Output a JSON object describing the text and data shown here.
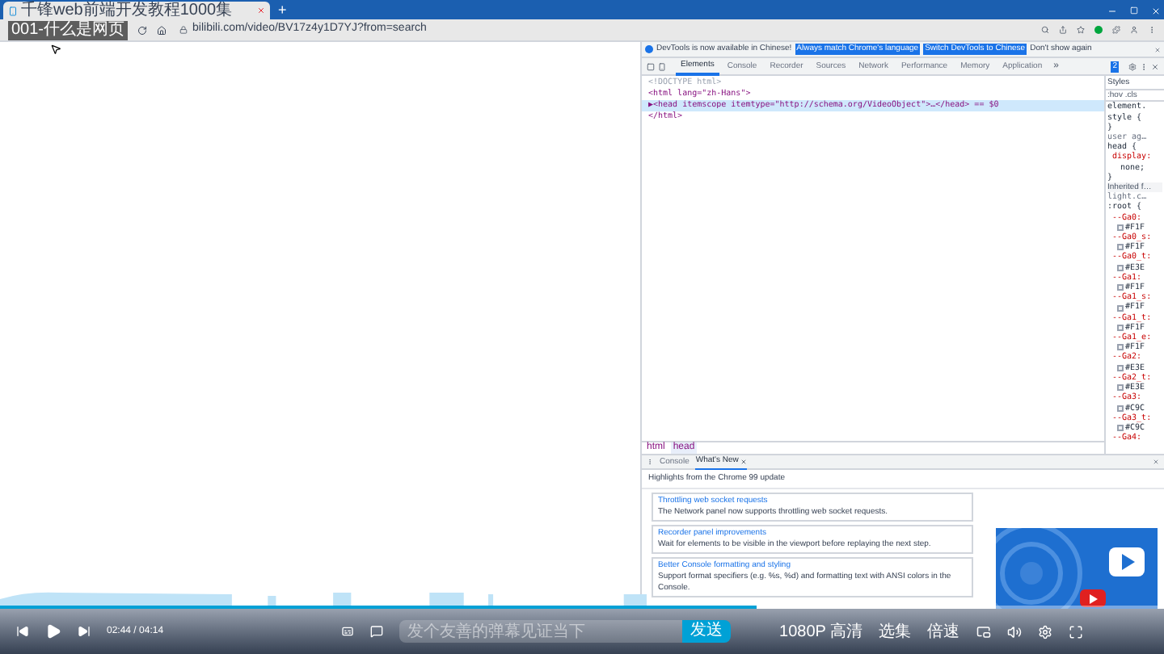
{
  "browser": {
    "tab_title": "千锋web前端开发教程1000集",
    "new_tab": "+",
    "url": "bilibili.com/video/BV17z4y1D7YJ?from=search"
  },
  "video_title": "001-什么是网页",
  "devtools": {
    "infobar": {
      "message": "DevTools is now available in Chinese!",
      "buttons": [
        "Always match Chrome's language",
        "Switch DevTools to Chinese"
      ],
      "link": "Don't show again"
    },
    "tabs": [
      {
        "label": "Elements",
        "selected": true
      },
      {
        "label": "Console",
        "selected": false
      },
      {
        "label": "Recorder",
        "selected": false
      },
      {
        "label": "Sources",
        "selected": false
      },
      {
        "label": "Network",
        "selected": false
      },
      {
        "label": "Performance",
        "selected": false
      },
      {
        "label": "Memory",
        "selected": false
      },
      {
        "label": "Application",
        "selected": false
      }
    ],
    "more": "»",
    "issues_count": "2",
    "dom_lines": [
      {
        "text": "<!DOCTYPE html>",
        "selected": false,
        "kind": "doctype"
      },
      {
        "text": "<html lang=\"zh-Hans\">",
        "selected": false,
        "kind": "tag"
      },
      {
        "text": "▶<head itemscope itemtype=\"http://schema.org/VideoObject\">…</head> == $0",
        "selected": true,
        "kind": "tag"
      },
      {
        "text": "</html>",
        "selected": false,
        "kind": "tag"
      }
    ],
    "styles": {
      "tab": "Styles",
      "filter": ":hov .cls",
      "lines": [
        {
          "text": "element.",
          "kind": "rule"
        },
        {
          "text": "style {",
          "kind": "rule"
        },
        {
          "text": "}",
          "kind": "rule"
        },
        {
          "text": "user ag…",
          "kind": "source"
        },
        {
          "text": "head {",
          "kind": "rule"
        },
        {
          "text": "display:",
          "kind": "prop"
        },
        {
          "text": "none;",
          "kind": "value"
        },
        {
          "text": "}",
          "kind": "rule"
        },
        {
          "text": "Inherited f…",
          "kind": "section"
        },
        {
          "text": "light.c…",
          "kind": "source"
        },
        {
          "text": ":root {",
          "kind": "rule"
        },
        {
          "text": "--Ga0:",
          "kind": "prop"
        },
        {
          "text": "#F1F",
          "kind": "swatch"
        },
        {
          "text": "--Ga0_s:",
          "kind": "prop"
        },
        {
          "text": "#F1F",
          "kind": "swatch"
        },
        {
          "text": "--Ga0_t:",
          "kind": "prop"
        },
        {
          "text": "#E3E",
          "kind": "swatch"
        },
        {
          "text": "--Ga1:",
          "kind": "prop"
        },
        {
          "text": "#F1F",
          "kind": "swatch"
        },
        {
          "text": "--Ga1_s:",
          "kind": "prop"
        },
        {
          "text": "#F1F",
          "kind": "swatch"
        },
        {
          "text": "--Ga1_t:",
          "kind": "prop"
        },
        {
          "text": "#F1F",
          "kind": "swatch"
        },
        {
          "text": "--Ga1_e:",
          "kind": "prop"
        },
        {
          "text": "#F1F",
          "kind": "swatch"
        },
        {
          "text": "--Ga2:",
          "kind": "prop"
        },
        {
          "text": "#E3E",
          "kind": "swatch"
        },
        {
          "text": "--Ga2_t:",
          "kind": "prop"
        },
        {
          "text": "#E3E",
          "kind": "swatch"
        },
        {
          "text": "--Ga3:",
          "kind": "prop"
        },
        {
          "text": "#C9C",
          "kind": "swatch"
        },
        {
          "text": "--Ga3_t:",
          "kind": "prop"
        },
        {
          "text": "#C9C",
          "kind": "swatch"
        },
        {
          "text": "--Ga4:",
          "kind": "prop"
        }
      ]
    },
    "breadcrumbs": [
      {
        "label": "html",
        "selected": false
      },
      {
        "label": "head",
        "selected": true
      }
    ],
    "drawer": {
      "tabs": [
        {
          "label": "Console",
          "selected": false,
          "closable": false
        },
        {
          "label": "What's New",
          "selected": true,
          "closable": true
        }
      ],
      "heading": "Highlights from the Chrome 99 update",
      "cards": [
        {
          "title": "Throttling web socket requests",
          "text": "The Network panel now supports throttling web socket requests."
        },
        {
          "title": "Recorder panel improvements",
          "text": "Wait for elements to be visible in the viewport before replaying the next step."
        },
        {
          "title": "Better Console formatting and styling",
          "text": "Support format specifiers (e.g. %s, %d) and formatting text with ANSI colors in the Console."
        }
      ]
    }
  },
  "player": {
    "progress": {
      "level": 0.65
    },
    "time": "02:44 / 04:14",
    "danmaku_placeholder": "发个友善的弹幕见证当下",
    "send": "发送",
    "quality": "1080P 高清",
    "episodes": "选集",
    "speed": "倍速"
  }
}
